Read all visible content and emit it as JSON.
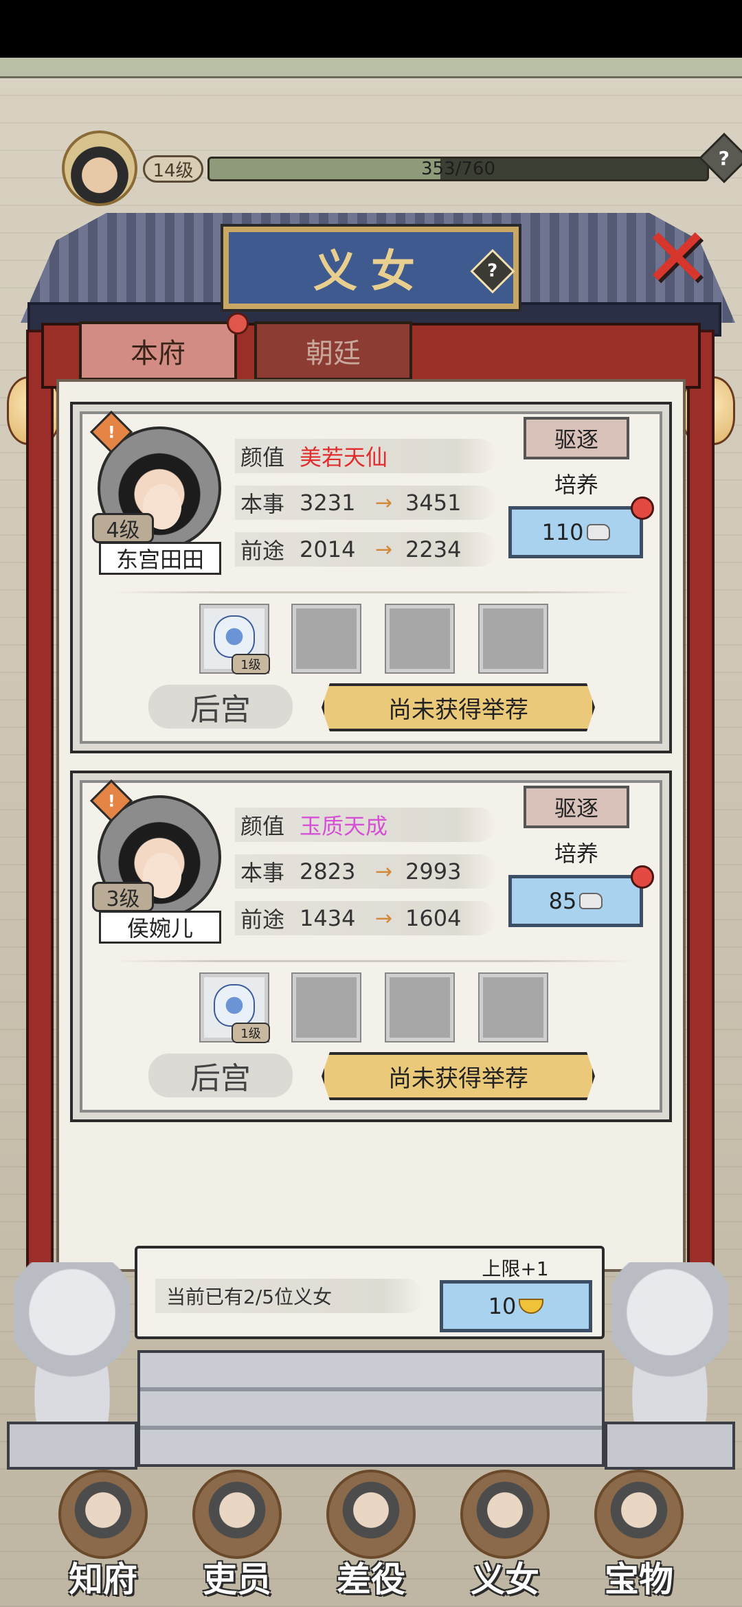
{
  "player": {
    "level": "14级",
    "xp_text": "353/760",
    "xp_progress": 0.464
  },
  "header": {
    "title": "义女",
    "help_symbol": "?",
    "close_symbol": "✕"
  },
  "tabs": [
    {
      "label": "本府",
      "active": true
    },
    {
      "label": "朝廷",
      "active": false
    }
  ],
  "daughters": [
    {
      "name": "东宫田田",
      "level": "4级",
      "looks_label": "颜值",
      "looks_value": "美若天仙",
      "looks_color": "#e02d2d",
      "ability_label": "本事",
      "ability_now": "3231",
      "ability_next": "3451",
      "future_label": "前途",
      "future_now": "2014",
      "future_next": "2234",
      "expel_label": "驱逐",
      "train_label": "培养",
      "train_cost": "110",
      "item_level": "1级",
      "harem_label": "后宫",
      "recommend_label": "尚未获得举荐"
    },
    {
      "name": "侯婉儿",
      "level": "3级",
      "looks_label": "颜值",
      "looks_value": "玉质天成",
      "looks_color": "#d650d6",
      "ability_label": "本事",
      "ability_now": "2823",
      "ability_next": "2993",
      "future_label": "前途",
      "future_now": "1434",
      "future_next": "1604",
      "expel_label": "驱逐",
      "train_label": "培养",
      "train_cost": "85",
      "item_level": "1级",
      "harem_label": "后宫",
      "recommend_label": "尚未获得举荐"
    }
  ],
  "footer": {
    "count_text": "当前已有2/5位义女",
    "limit_label": "上限+1",
    "limit_cost": "10"
  },
  "arrow_symbol": "→",
  "warn_symbol": "!",
  "nav": [
    {
      "label": "知府"
    },
    {
      "label": "吏员"
    },
    {
      "label": "差役"
    },
    {
      "label": "义女"
    },
    {
      "label": "宝物"
    }
  ]
}
